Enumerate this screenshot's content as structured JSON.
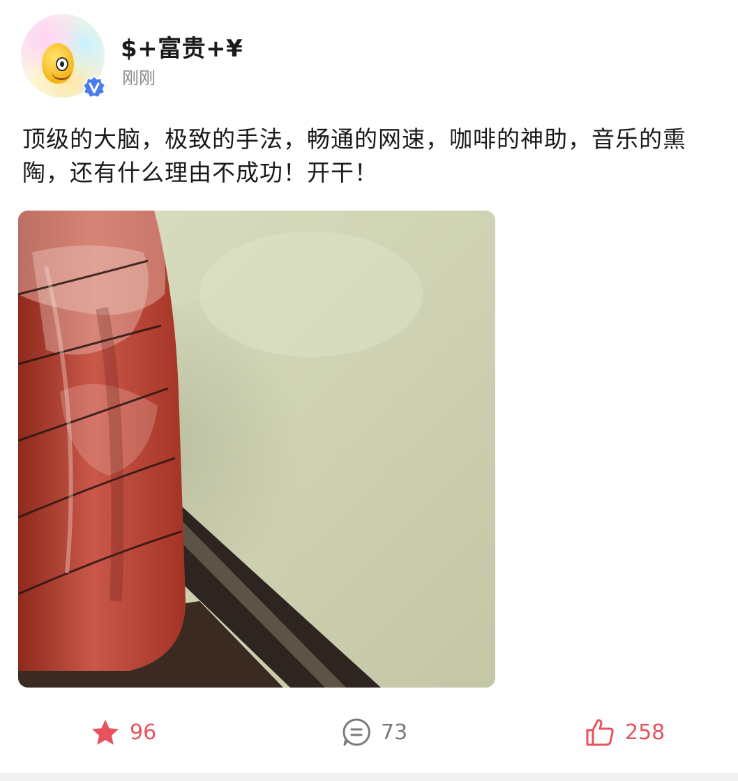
{
  "post": {
    "author": {
      "name": "$+富贵+¥",
      "time": "刚刚",
      "avatar_icon": "emoji-face-avatar",
      "verified_icon": "verified-badge-icon",
      "verified_color": "#4a7cf0"
    },
    "text": "顶级的大脑，极致的手法，畅通的网速，咖啡的神助，音乐的熏陶，还有什么理由不成功！开干！",
    "image": {
      "description_icon": "photo-drink-cup-on-table"
    },
    "actions": {
      "favorite": {
        "icon": "star-icon",
        "count": "96",
        "color": "#e6525e"
      },
      "comment": {
        "icon": "comment-icon",
        "count": "73",
        "color": "#7a7a7a"
      },
      "like": {
        "icon": "thumbs-up-icon",
        "count": "258",
        "color": "#e6525e"
      }
    }
  }
}
